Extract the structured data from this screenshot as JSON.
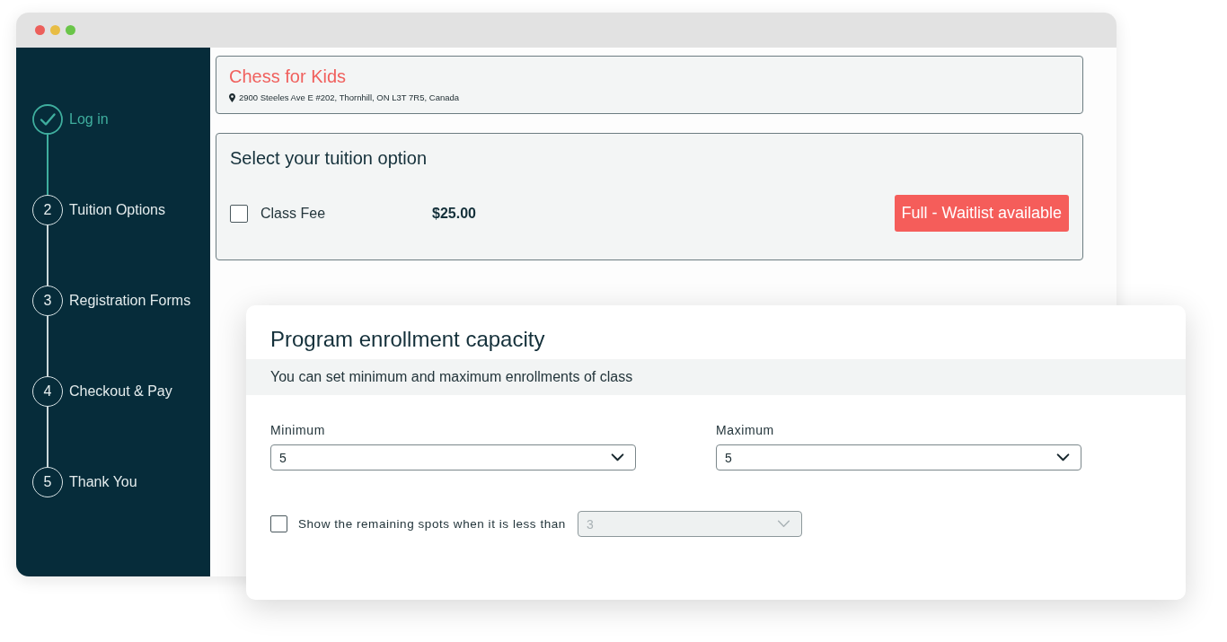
{
  "sidebar": {
    "steps": [
      {
        "label": "Log in",
        "completed": true
      },
      {
        "number": "2",
        "label": "Tuition Options",
        "completed": false
      },
      {
        "number": "3",
        "label": "Registration Forms",
        "completed": false
      },
      {
        "number": "4",
        "label": "Checkout & Pay",
        "completed": false
      },
      {
        "number": "5",
        "label": "Thank You",
        "completed": false
      }
    ]
  },
  "program": {
    "title": "Chess for Kids",
    "address": "2900 Steeles Ave E #202, Thornhill, ON L3T 7R5, Canada"
  },
  "tuition": {
    "heading": "Select your tuition option",
    "options": [
      {
        "label": "Class Fee",
        "price": "$25.00",
        "checked": false,
        "status": "Full - Waitlist available"
      }
    ]
  },
  "capacity_panel": {
    "title": "Program enrollment capacity",
    "subtitle": "You can set minimum and maximum enrollments of class",
    "fields": [
      {
        "label": "Minimum",
        "value": "5"
      },
      {
        "label": "Maximum",
        "value": "5"
      }
    ],
    "remaining_spots": {
      "checked": false,
      "label": "Show the remaining spots when it is less than",
      "value": "3",
      "disabled": true
    }
  }
}
